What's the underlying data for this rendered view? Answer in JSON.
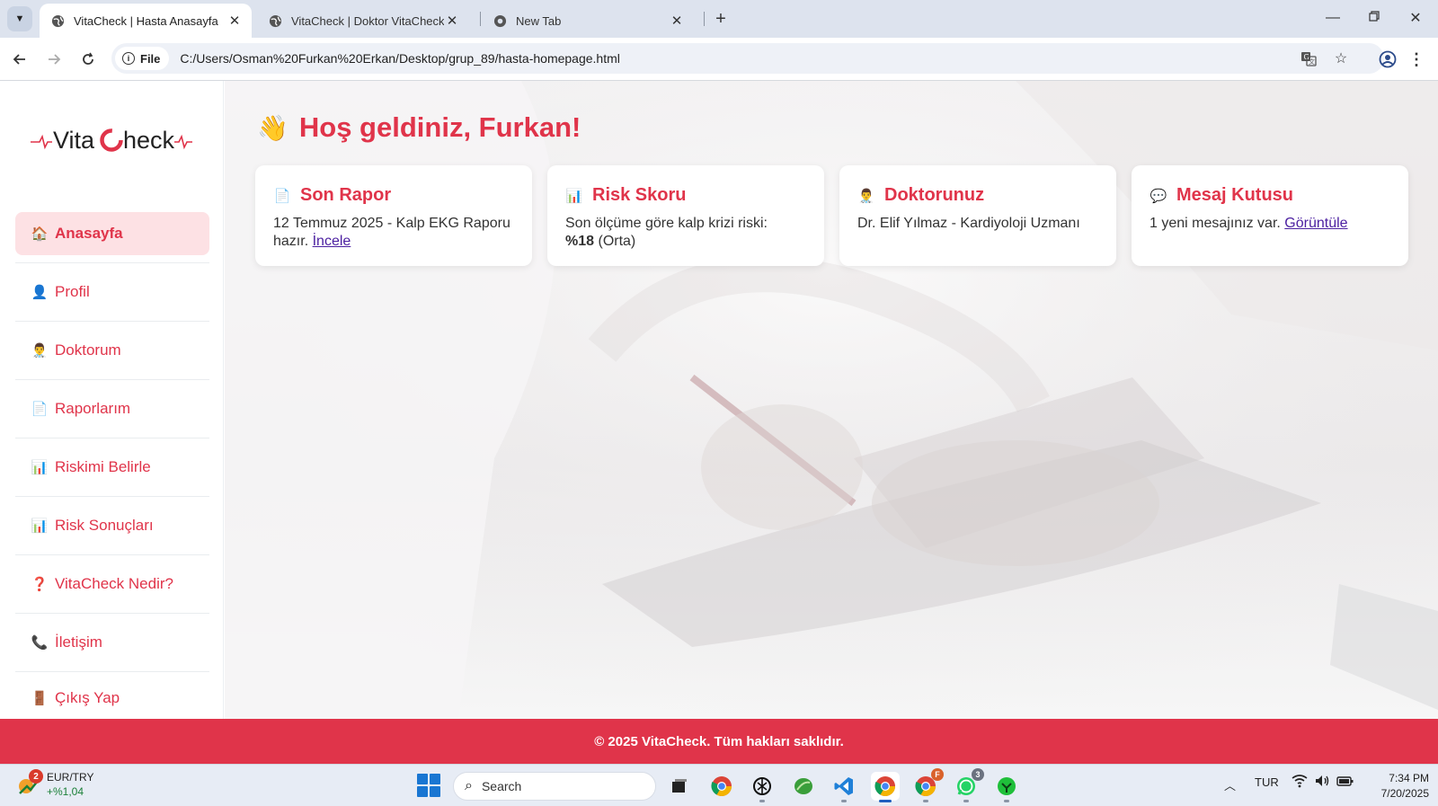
{
  "browser": {
    "tabs": [
      {
        "title": "VitaCheck | Hasta Anasayfa",
        "active": true
      },
      {
        "title": "VitaCheck | Doktor VitaCheck N",
        "active": false
      },
      {
        "title": "New Tab",
        "active": false
      }
    ],
    "address": {
      "chip_label": "File",
      "url": "C:/Users/Osman%20Furkan%20Erkan/Desktop/grup_89/hasta-homepage.html"
    }
  },
  "logo": {
    "text_left": "Vita",
    "text_right": "heck",
    "accent": "#e0344a"
  },
  "sidebar": {
    "items": [
      {
        "label": "Anasayfa",
        "icon": "house-icon",
        "glyph": "🏠",
        "active": true
      },
      {
        "label": "Profil",
        "icon": "user-icon",
        "glyph": "👤"
      },
      {
        "label": "Doktorum",
        "icon": "doctor-icon",
        "glyph": "👨‍⚕️"
      },
      {
        "label": "Raporlarım",
        "icon": "document-icon",
        "glyph": "📄"
      },
      {
        "label": "Riskimi Belirle",
        "icon": "chart-icon",
        "glyph": "📊"
      },
      {
        "label": "Risk Sonuçları",
        "icon": "chart-icon",
        "glyph": "📊"
      },
      {
        "label": "VitaCheck Nedir?",
        "icon": "question-icon",
        "glyph": "❓"
      },
      {
        "label": "İletişim",
        "icon": "phone-icon",
        "glyph": "📞"
      },
      {
        "label": "Çıkış Yap",
        "icon": "door-icon",
        "glyph": "🚪"
      }
    ]
  },
  "main": {
    "welcome": "Hoş geldiniz, Furkan!",
    "welcome_icon": "👋",
    "cards": [
      {
        "title": "Son Rapor",
        "icon": "document-icon",
        "glyph": "📄",
        "text": "12 Temmuz 2025 - Kalp EKG Raporu hazır.",
        "link": "İncele"
      },
      {
        "title": "Risk Skoru",
        "icon": "chart-icon",
        "glyph": "📊",
        "text": "Son ölçüme göre kalp krizi riski:",
        "value": "%18",
        "suffix": "(Orta)"
      },
      {
        "title": "Doktorunuz",
        "icon": "doctor-icon",
        "glyph": "👨‍⚕️",
        "text": "Dr. Elif Yılmaz - Kardiyoloji Uzmanı"
      },
      {
        "title": "Mesaj Kutusu",
        "icon": "speech-bubble-icon",
        "glyph": "💬",
        "text": "1 yeni mesajınız var.",
        "link": "Görüntüle"
      }
    ]
  },
  "footer": {
    "text": "© 2025 VitaCheck. Tüm hakları saklıdır."
  },
  "taskbar": {
    "widget": {
      "badge": "2",
      "symbol": "EUR/TRY",
      "change": "+%1,04"
    },
    "search_placeholder": "Search",
    "language": "TUR",
    "time": "7:34 PM",
    "date": "7/20/2025",
    "badges": {
      "firefox": "F",
      "whatsapp": "3"
    }
  },
  "colors": {
    "brand": "#e0344a",
    "link": "#4b1fa0"
  }
}
